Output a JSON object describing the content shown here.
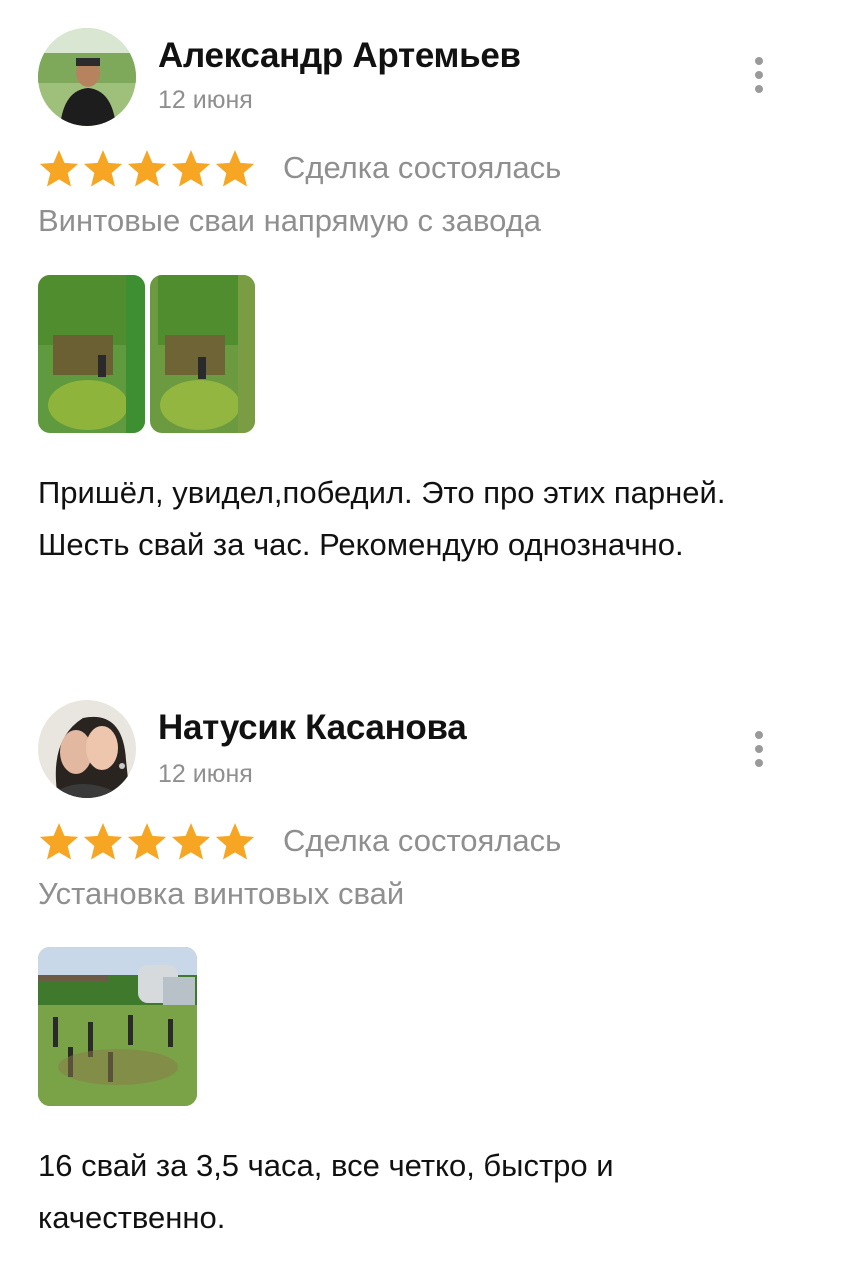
{
  "reviews": [
    {
      "author": "Александр Артемьев",
      "date": "12 июня",
      "rating": 5,
      "deal_status": "Сделка состоялась",
      "service": "Винтовые сваи напрямую с завода",
      "photos_count": 2,
      "text": "Пришёл, увидел,победил. Это про этих парней. Шесть свай за час. Рекомендую однозначно.",
      "avatar_icon": "avatar-man-photo"
    },
    {
      "author": "Натусик Касанова",
      "date": "12 июня",
      "rating": 5,
      "deal_status": "Сделка состоялась",
      "service": "Установка винтовых свай",
      "photos_count": 1,
      "text": "16 свай  за 3,5 часа, все четко, быстро и качественно.",
      "avatar_icon": "avatar-woman-photo"
    }
  ],
  "colors": {
    "star": "#f6a623",
    "muted_text": "#8f8f8f",
    "body_text": "#111111",
    "menu_dots": "#9a9a9a"
  },
  "icons": {
    "menu": "more-vertical-icon",
    "star": "star-icon"
  }
}
